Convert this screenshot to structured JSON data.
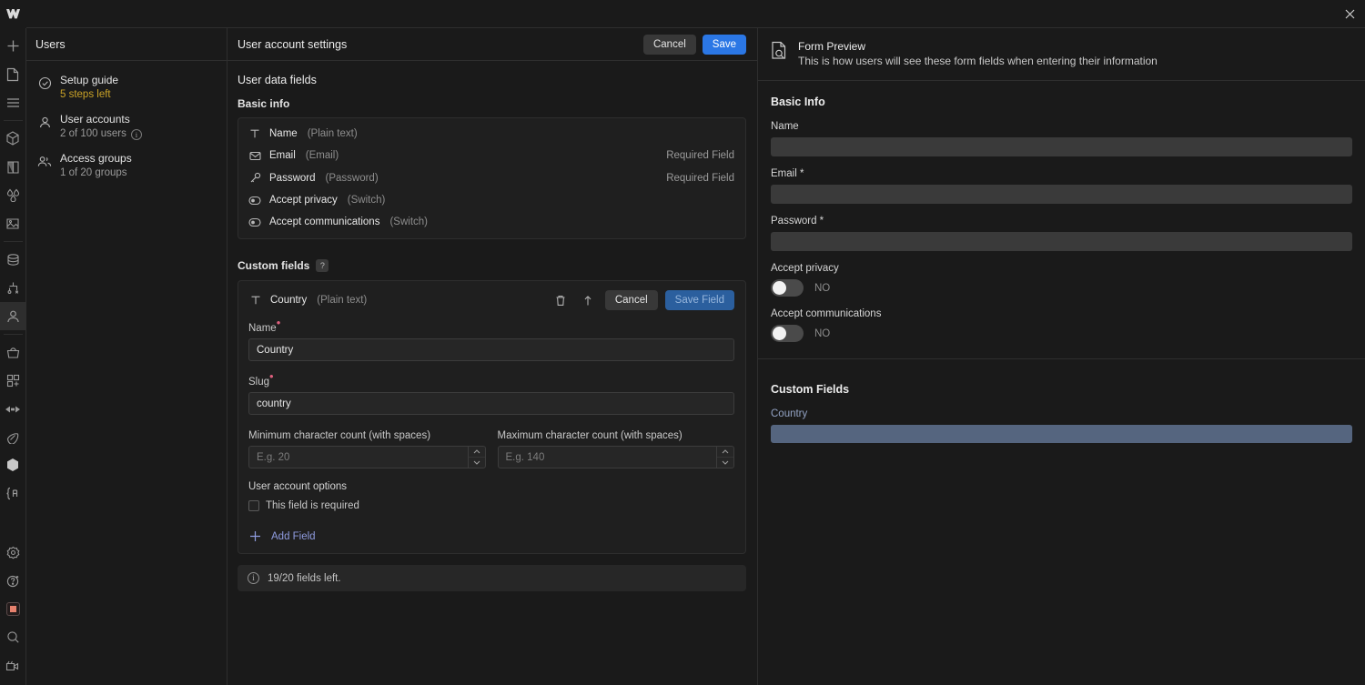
{
  "app": {
    "logo_name": "webflow-logo",
    "close_label": "×"
  },
  "rail": {
    "items": [
      {
        "name": "add-icon"
      },
      {
        "name": "pages-icon"
      },
      {
        "name": "navigator-icon"
      },
      {
        "name": "components-icon"
      },
      {
        "name": "style-panel-icon"
      },
      {
        "name": "variables-icon"
      },
      {
        "name": "assets-icon"
      },
      {
        "name": "cms-icon"
      },
      {
        "name": "logic-icon"
      },
      {
        "name": "users-icon"
      },
      {
        "name": "ecommerce-icon"
      },
      {
        "name": "apps-icon"
      },
      {
        "name": "interactions-icon"
      },
      {
        "name": "audit-icon"
      },
      {
        "name": "libraries-icon"
      },
      {
        "name": "code-icon"
      }
    ],
    "bottom_items": [
      {
        "name": "settings-icon"
      },
      {
        "name": "help-icon"
      },
      {
        "name": "color-swatch-icon"
      },
      {
        "name": "search-icon"
      },
      {
        "name": "video-icon"
      }
    ]
  },
  "users_panel": {
    "title": "Users",
    "items": [
      {
        "icon": "check-circle-icon",
        "label": "Setup guide",
        "sublabel": "5 steps left",
        "warn": true,
        "info": false
      },
      {
        "icon": "user-icon",
        "label": "User accounts",
        "sublabel": "2 of 100 users",
        "warn": false,
        "info": true,
        "info_glyph": "i"
      },
      {
        "icon": "users-group-icon",
        "label": "Access groups",
        "sublabel": "1 of 20 groups",
        "warn": false,
        "info": false
      }
    ]
  },
  "center": {
    "header": {
      "title": "User account settings",
      "cancel_label": "Cancel",
      "save_label": "Save"
    },
    "section_title": "User data fields",
    "basic_info": {
      "heading": "Basic info",
      "fields": [
        {
          "icon": "text-icon",
          "name": "Name",
          "type": "(Plain text)",
          "required_text": ""
        },
        {
          "icon": "envelope-icon",
          "name": "Email",
          "type": "(Email)",
          "required_text": "Required Field"
        },
        {
          "icon": "key-icon",
          "name": "Password",
          "type": "(Password)",
          "required_text": "Required Field"
        },
        {
          "icon": "switch-icon",
          "name": "Accept privacy",
          "type": "(Switch)",
          "required_text": ""
        },
        {
          "icon": "switch-icon",
          "name": "Accept communications",
          "type": "(Switch)",
          "required_text": ""
        }
      ]
    },
    "custom_fields": {
      "heading": "Custom fields",
      "help_glyph": "?",
      "editor": {
        "icon": "text-icon",
        "field_name": "Country",
        "field_type": "(Plain text)",
        "delete_icon": "trash-icon",
        "move_icon": "move-up-icon",
        "cancel_label": "Cancel",
        "save_label": "Save Field",
        "name_label": "Name",
        "name_value": "Country",
        "slug_label": "Slug",
        "slug_value": "country",
        "min_label": "Minimum character count (with spaces)",
        "min_placeholder": "E.g. 20",
        "min_value": "",
        "max_label": "Maximum character count (with spaces)",
        "max_placeholder": "E.g. 140",
        "max_value": "",
        "options_title": "User account options",
        "required_checkbox_label": "This field is required",
        "required_checked": false
      },
      "add_field_label": "Add Field",
      "add_field_icon": "plus-icon"
    },
    "notice": {
      "icon": "info-icon",
      "glyph": "i",
      "text": "19/20 fields left."
    }
  },
  "preview": {
    "header": {
      "icon": "document-search-icon",
      "title": "Form Preview",
      "subtitle": "This is how users will see these form fields when entering their information"
    },
    "basic_info_heading": "Basic Info",
    "basic_fields": [
      {
        "label": "Name",
        "kind": "input"
      },
      {
        "label": "Email *",
        "kind": "input"
      },
      {
        "label": "Password *",
        "kind": "input"
      }
    ],
    "switch_fields": [
      {
        "label": "Accept privacy",
        "value": "NO",
        "on": false
      },
      {
        "label": "Accept communications",
        "value": "NO",
        "on": false
      }
    ],
    "custom_fields_heading": "Custom Fields",
    "custom_fields": [
      {
        "label": "Country",
        "kind": "input-highlight"
      }
    ]
  },
  "colors": {
    "accent_blue": "#2b77e5",
    "warn_yellow": "#c9a227",
    "link_purple": "#8f9ce0",
    "required_pink": "#e0607e",
    "preview_highlight": "#55657f",
    "panel_bg": "#1a1a1a",
    "card_bg": "#1f1f1f",
    "border": "#2e2e2e"
  }
}
